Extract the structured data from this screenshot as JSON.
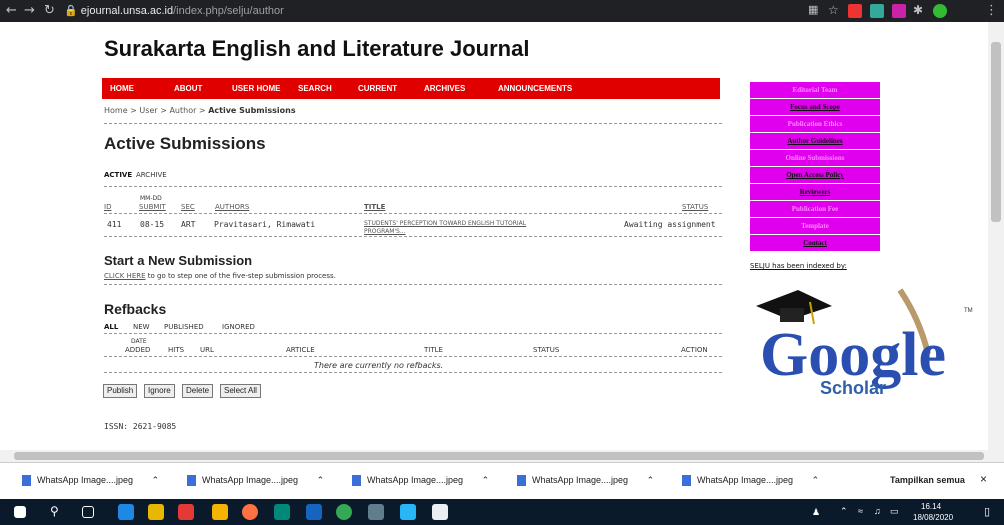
{
  "browser": {
    "url_domain": "ejournal.unsa.ac.id",
    "url_path": "/index.php/selju/author"
  },
  "page": {
    "journal_title": "Surakarta English and Literature Journal",
    "menu": [
      "HOME",
      "ABOUT",
      "USER HOME",
      "SEARCH",
      "CURRENT",
      "ARCHIVES",
      "ANNOUNCEMENTS"
    ],
    "breadcrumb": {
      "home": "Home",
      "sep": " > ",
      "user": "User",
      "author": "Author",
      "current": "Active Submissions"
    },
    "heading": "Active Submissions",
    "tabs": {
      "active": "ACTIVE",
      "archive": "ARCHIVE"
    },
    "table": {
      "headers": {
        "id": "ID",
        "date_top": "MM-DD",
        "date_bottom": "SUBMIT",
        "sec": "SEC",
        "authors": "AUTHORS",
        "title": "TITLE",
        "status": "STATUS"
      },
      "row": {
        "id": "411",
        "date": "08-15",
        "sec": "ART",
        "authors": "Pravitasari, Rimawati",
        "title_line1": "STUDENTS' PERCEPTION TOWARD ENGLISH TUTORIAL",
        "title_line2": "PROGRAM'S...",
        "status": "Awaiting assignment"
      }
    },
    "new_submission": {
      "heading": "Start a New Submission",
      "link": "CLICK HERE",
      "text": " to go to step one of the five-step submission process."
    },
    "refbacks": {
      "heading": "Refbacks",
      "filters": [
        "ALL",
        "NEW",
        "PUBLISHED",
        "IGNORED"
      ],
      "headers": {
        "date_top": "DATE",
        "date_bottom": "ADDED",
        "hits": "HITS",
        "url": "URL",
        "article": "ARTICLE",
        "title": "TITLE",
        "status": "STATUS",
        "action": "ACTION"
      },
      "empty": "There are currently no refbacks.",
      "buttons": [
        "Publish",
        "Ignore",
        "Delete",
        "Select All"
      ]
    },
    "issn": "ISSN: 2621-9085"
  },
  "sidebar": {
    "items": [
      "Editorial Team",
      "Focus and Scope",
      "Publication Ethics",
      "Author Guidelines",
      "Online Submissions",
      "Open Access Policy",
      "Reviewers",
      "Publication Fee",
      "Template",
      "Contact"
    ],
    "indexed": "SELJU has been indexed by:",
    "google": "Google",
    "scholar": "Scholar",
    "tm": "TM"
  },
  "downloads": {
    "items": [
      "WhatsApp Image....jpeg",
      "WhatsApp Image....jpeg",
      "WhatsApp Image....jpeg",
      "WhatsApp Image....jpeg",
      "WhatsApp Image....jpeg"
    ],
    "show_all": "Tampilkan semua"
  },
  "taskbar": {
    "time": "16.14",
    "date": "18/08/2020"
  }
}
